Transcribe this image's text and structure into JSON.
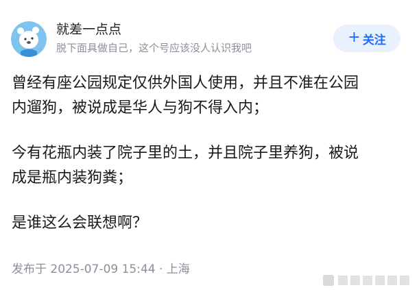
{
  "author": {
    "name": "就差一点点",
    "bio": "脱下面具做自己，这个号应该没人认识我吧",
    "avatar_icon": "bear-avatar-icon"
  },
  "follow_button": {
    "icon": "+",
    "label": "关注"
  },
  "post": {
    "paragraphs": [
      [
        "曾经有座公园规定仅供外国人使用，并且不准在公园",
        "内遛狗，被说成是华人与狗不得入内；"
      ],
      [
        "今有花瓶内装了院子里的土，并且院子里养狗，被说",
        "成是瓶内装狗粪；"
      ],
      [
        "是谁这么会联想啊？"
      ]
    ]
  },
  "footer": {
    "meta": "发布于 2025-07-09 15:44 · 上海"
  },
  "colors": {
    "accent": "#1e6cf7",
    "follow_bg": "#e9f0fe",
    "muted": "#8a8f99",
    "text": "#1a1a1a",
    "avatar_bg": "#7fc3ef"
  }
}
